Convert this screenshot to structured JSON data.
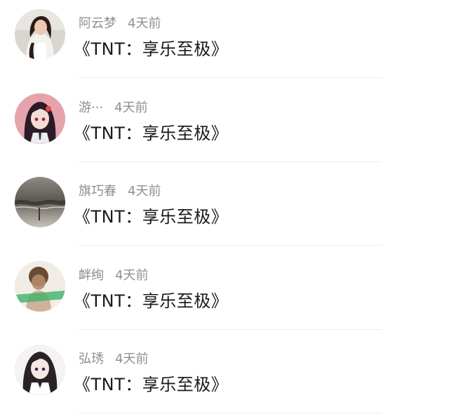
{
  "items": [
    {
      "name": "阿云梦",
      "time": "4天前",
      "title": "《TNT：享乐至极》",
      "avatar_icon": "woman-photo-avatar"
    },
    {
      "name": "游···",
      "time": "4天前",
      "title": "《TNT：享乐至极》",
      "avatar_icon": "anime-girl-avatar"
    },
    {
      "name": "旗巧春",
      "time": "4天前",
      "title": "《TNT：享乐至极》",
      "avatar_icon": "water-scene-avatar"
    },
    {
      "name": "衅绚",
      "time": "4天前",
      "title": "《TNT：享乐至极》",
      "avatar_icon": "sepia-person-avatar"
    },
    {
      "name": "弘琇",
      "time": "4天前",
      "title": "《TNT：享乐至极》",
      "avatar_icon": "anime-character-avatar"
    }
  ],
  "colors": {
    "name_text": "#8f8f8f",
    "title_text": "#1a1a1a",
    "divider": "#ececec"
  }
}
